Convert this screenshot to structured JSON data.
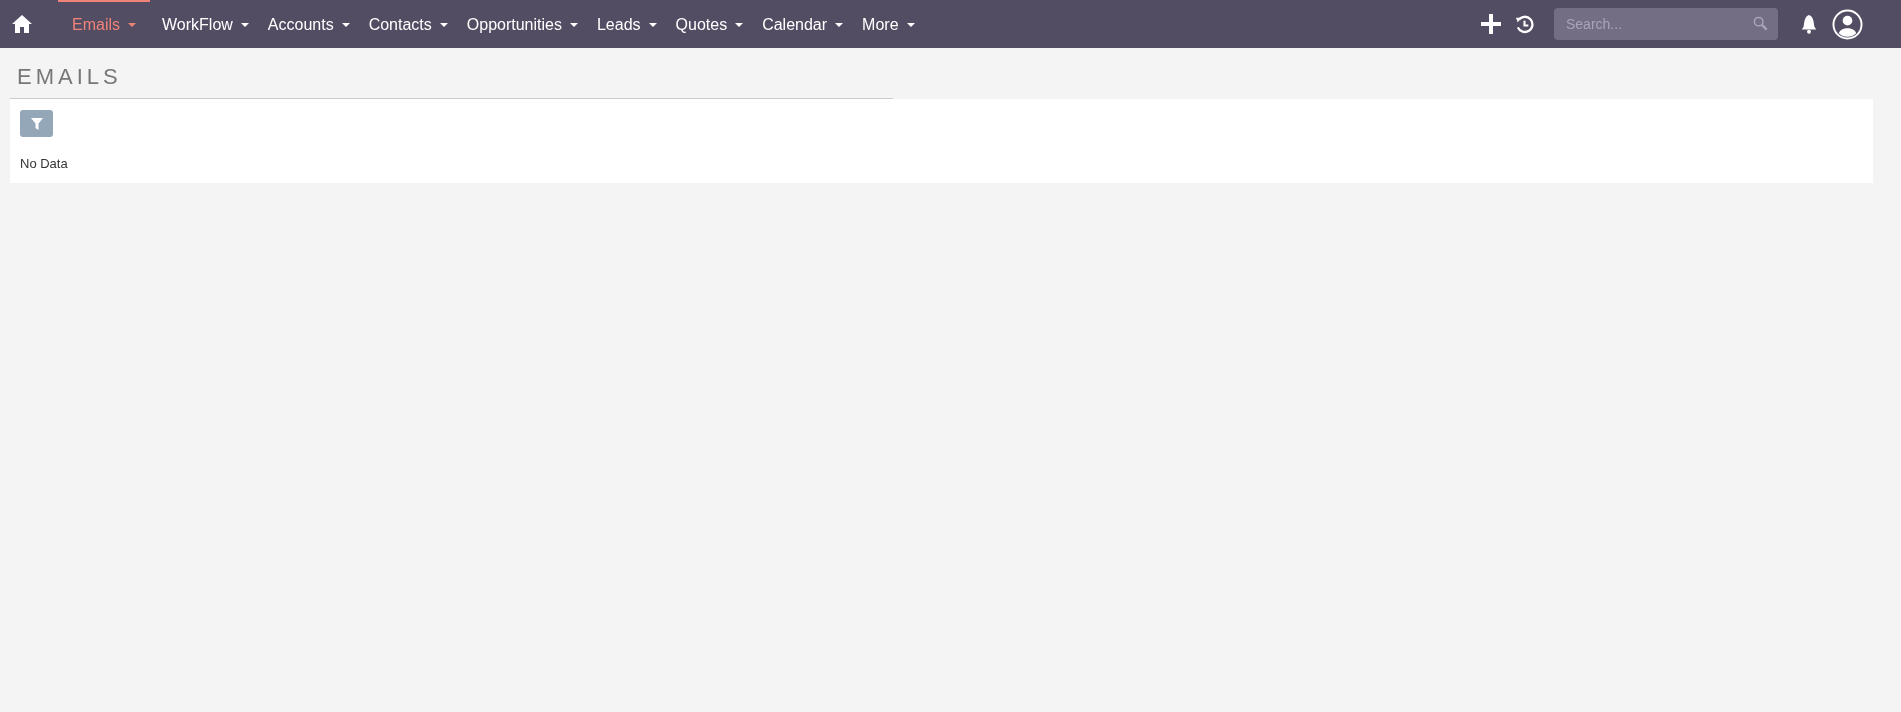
{
  "nav": {
    "items": [
      {
        "label": "Emails",
        "selected": true
      },
      {
        "label": "WorkFlow",
        "selected": false
      },
      {
        "label": "Accounts",
        "selected": false
      },
      {
        "label": "Contacts",
        "selected": false
      },
      {
        "label": "Opportunities",
        "selected": false
      },
      {
        "label": "Leads",
        "selected": false
      },
      {
        "label": "Quotes",
        "selected": false
      },
      {
        "label": "Calendar",
        "selected": false
      },
      {
        "label": "More",
        "selected": false
      }
    ],
    "search": {
      "placeholder": "Search..."
    }
  },
  "page": {
    "title": "EMAILS",
    "empty_message": "No Data"
  }
}
